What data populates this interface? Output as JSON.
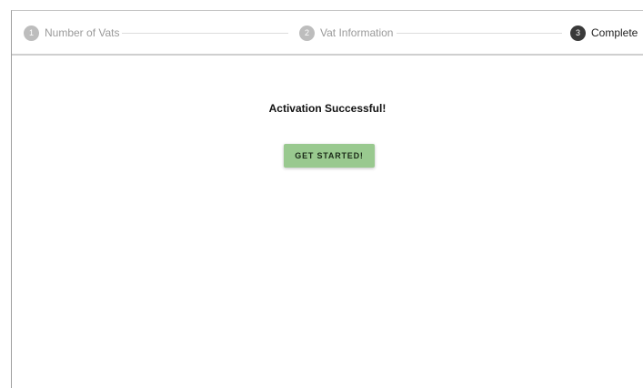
{
  "stepper": {
    "steps": [
      {
        "number": "1",
        "label": "Number of Vats",
        "state": "inactive"
      },
      {
        "number": "2",
        "label": "Vat Information",
        "state": "inactive"
      },
      {
        "number": "3",
        "label": "Complete",
        "state": "active"
      }
    ]
  },
  "main": {
    "title": "Activation Successful!",
    "button_label": "GET STARTED!"
  },
  "colors": {
    "button_bg": "#99c98f",
    "active_step": "#3a3a3a",
    "inactive_step": "#bdbdbd"
  }
}
